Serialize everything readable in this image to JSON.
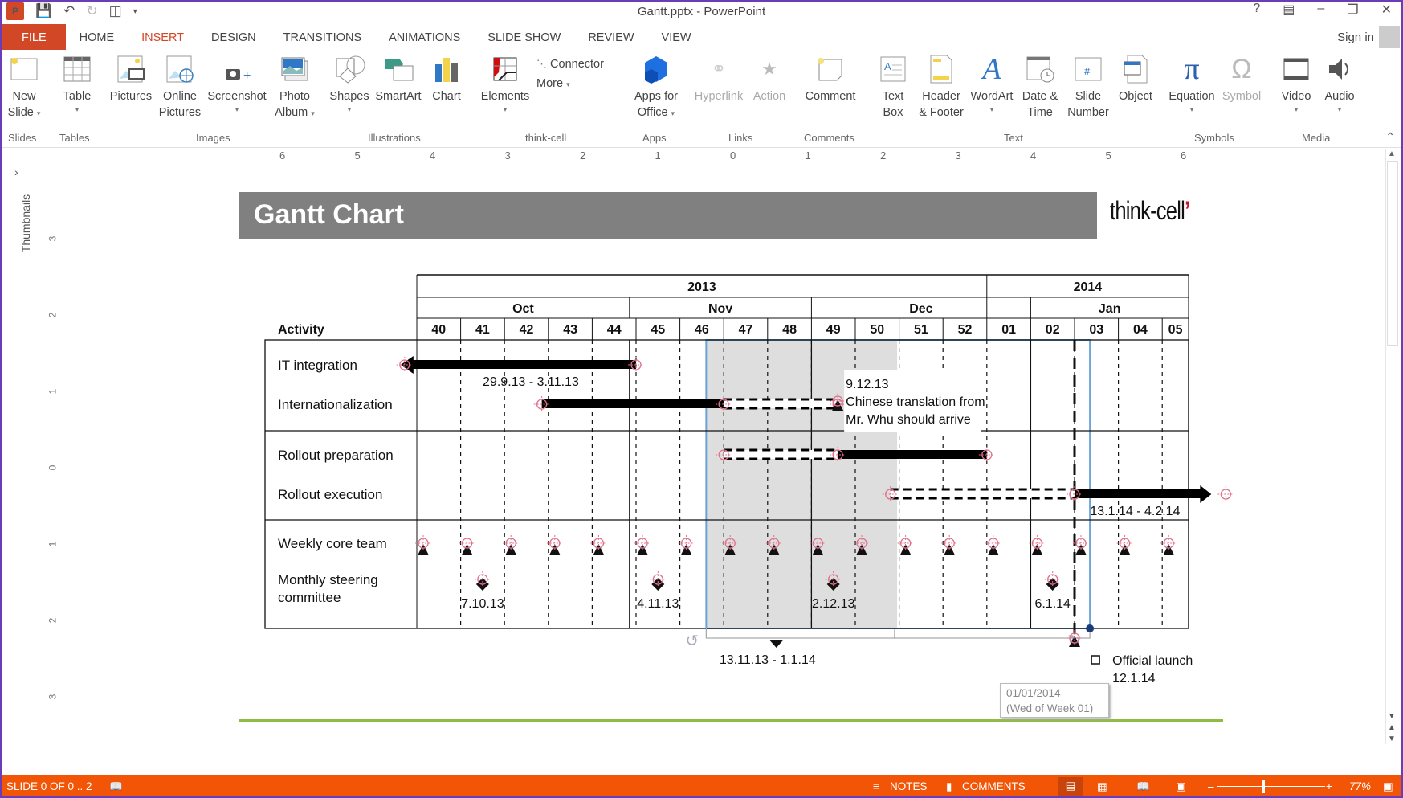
{
  "window": {
    "title": "Gantt.pptx - PowerPoint",
    "controls": [
      "?",
      "ribbon-display",
      "minimize",
      "restore",
      "close"
    ]
  },
  "qat": [
    "app-icon",
    "save-icon",
    "undo-icon",
    "redo-icon",
    "present-icon",
    "customize-icon"
  ],
  "tabs": [
    {
      "label": "FILE"
    },
    {
      "label": "HOME"
    },
    {
      "label": "INSERT",
      "active": true
    },
    {
      "label": "DESIGN"
    },
    {
      "label": "TRANSITIONS"
    },
    {
      "label": "ANIMATIONS"
    },
    {
      "label": "SLIDE SHOW"
    },
    {
      "label": "REVIEW"
    },
    {
      "label": "VIEW"
    }
  ],
  "signin": "Sign in",
  "ribbon": {
    "buttons": {
      "new_slide": [
        "New",
        "Slide"
      ],
      "table": "Table",
      "pictures": "Pictures",
      "online_pictures": [
        "Online",
        "Pictures"
      ],
      "screenshot": "Screenshot",
      "photo_album": [
        "Photo",
        "Album"
      ],
      "shapes": "Shapes",
      "smartart": "SmartArt",
      "chart": "Chart",
      "elements": "Elements",
      "connector": "Connector",
      "more": "More",
      "apps_for_office": [
        "Apps for",
        "Office"
      ],
      "hyperlink": "Hyperlink",
      "action": "Action",
      "comment": "Comment",
      "text_box": [
        "Text",
        "Box"
      ],
      "header_footer": [
        "Header",
        "& Footer"
      ],
      "wordart": "WordArt",
      "date_time": [
        "Date &",
        "Time"
      ],
      "slide_number": [
        "Slide",
        "Number"
      ],
      "object": "Object",
      "equation": "Equation",
      "symbol": "Symbol",
      "video": "Video",
      "audio": "Audio"
    },
    "groups": {
      "slides": "Slides",
      "tables": "Tables",
      "images": "Images",
      "illustrations": "Illustrations",
      "think_cell": "think-cell",
      "apps": "Apps",
      "links": "Links",
      "comments": "Comments",
      "text": "Text",
      "symbols": "Symbols",
      "media": "Media"
    }
  },
  "ruler": {
    "horizontal": [
      "6",
      "5",
      "4",
      "3",
      "2",
      "1",
      "0",
      "1",
      "2",
      "3",
      "4",
      "5",
      "6"
    ],
    "vertical": [
      "3",
      "2",
      "1",
      "0",
      "1",
      "2",
      "3"
    ]
  },
  "thumbnails_label": "Thumbnails",
  "slide": {
    "title": "Gantt Chart",
    "logo": "think-cell"
  },
  "chart_data": {
    "type": "gantt",
    "activity_header": "Activity",
    "years": [
      {
        "label": "2013",
        "span": 13
      },
      {
        "label": "2014",
        "span": 5
      }
    ],
    "months": [
      {
        "label": "Oct",
        "span": 5
      },
      {
        "label": "Nov",
        "span": 4
      },
      {
        "label": "Dec",
        "span": 5
      },
      {
        "label": "Jan",
        "span": 4.5
      }
    ],
    "weeks": [
      "40",
      "41",
      "42",
      "43",
      "44",
      "45",
      "46",
      "47",
      "48",
      "49",
      "50",
      "51",
      "52",
      "01",
      "02",
      "03",
      "04",
      "05"
    ],
    "groups": [
      {
        "rows": [
          {
            "label": "IT integration",
            "bars": [
              {
                "start": 39.85,
                "end": 45.0,
                "style": "solid",
                "arrow_left": true
              }
            ],
            "label_text": "29.9.13 - 3.11.13",
            "label_week": 42.6
          },
          {
            "label": "Internationalization",
            "bars": [
              {
                "start": 42.85,
                "end": 47.0,
                "style": "solid"
              },
              {
                "start": 47.0,
                "end": 49.6,
                "style": "dashed"
              }
            ],
            "milestone": {
              "week": 49.6,
              "shape": "triangle",
              "text": [
                "9.12.13",
                "Chinese translation from",
                "Mr. Whu should arrive"
              ]
            }
          }
        ]
      },
      {
        "rows": [
          {
            "label": "Rollout preparation",
            "bars": [
              {
                "start": 47.0,
                "end": 49.6,
                "style": "dashed"
              },
              {
                "start": 49.6,
                "end": 53.0,
                "style": "solid"
              }
            ]
          },
          {
            "label": "Rollout execution",
            "bars": [
              {
                "start": 50.8,
                "end": 55.0,
                "style": "dashed"
              },
              {
                "start": 55.0,
                "end": 57.9,
                "style": "solid",
                "arrow_right": true
              }
            ],
            "label_text": "13.1.14 - 4.2.14",
            "label_week": 55.3
          }
        ]
      },
      {
        "rows": [
          {
            "label": "Weekly core team",
            "milestones_weekly": true,
            "shape": "triangle"
          },
          {
            "label": [
              "Monthly steering",
              "committee"
            ],
            "milestones": [
              {
                "week": 41.5,
                "text": "7.10.13"
              },
              {
                "week": 45.5,
                "text": "4.11.13"
              },
              {
                "week": 49.5,
                "text": "2.12.13"
              },
              {
                "week": 54.5,
                "text": "6.1.14"
              }
            ],
            "shape": "diamond"
          }
        ]
      }
    ],
    "highlight": {
      "start": 46.6,
      "end": 51.1,
      "label": "13.11.13 - 1.1.14"
    },
    "today_line": {
      "week": 55.0
    },
    "official_launch": {
      "label": "Official launch",
      "date": "12.1.14",
      "week": 55.0
    },
    "tooltip": [
      "01/01/2014",
      "(Wed of Week 01)"
    ]
  },
  "statusbar": {
    "slide_info": "SLIDE 0 OF 0 .. 2",
    "notes": "NOTES",
    "comments": "COMMENTS",
    "zoom": "77%",
    "zoom_level": 0.77
  }
}
